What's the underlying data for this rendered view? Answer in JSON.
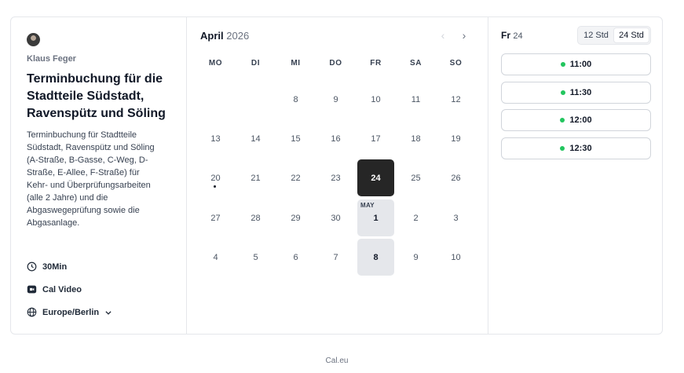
{
  "organizer": {
    "name": "Klaus Feger"
  },
  "event": {
    "title": "Terminbuchung für die Stadtteile Südstadt, Ravenspütz und Söling",
    "description": "Terminbuchung für Stadtteile Südstadt, Ravenspütz und Söling (A-Straße, B-Gasse, C-Weg, D-Straße, E-Allee, F-Straße) für Kehr- und Überprüfungsarbeiten (alle 2 Jahre) und die Abgaswegeprüfung sowie die Abgasanlage.",
    "duration": "30Min",
    "location": "Cal Video",
    "timezone": "Europe/Berlin"
  },
  "calendar": {
    "month": "April",
    "year": "2026",
    "weekdays": [
      "MO",
      "DI",
      "MI",
      "DO",
      "FR",
      "SA",
      "SO"
    ],
    "rows": [
      [
        null,
        null,
        "8",
        "9",
        "10",
        "11",
        "12"
      ],
      [
        "13",
        "14",
        "15",
        "16",
        "17",
        "18",
        "19"
      ],
      [
        "20",
        "21",
        "22",
        "23",
        "24",
        "25",
        "26"
      ],
      [
        "27",
        "28",
        "29",
        "30",
        "1",
        "2",
        "3"
      ],
      [
        "4",
        "5",
        "6",
        "7",
        "8",
        "9",
        "10"
      ]
    ],
    "selected": "24",
    "available": [
      "24",
      "1",
      "8"
    ],
    "next_month_label": "MAY",
    "today_marker": "20"
  },
  "schedule": {
    "day_label": "Fr",
    "day_number": "24",
    "format_options": [
      "12 Std",
      "24 Std"
    ],
    "active_format": "24 Std",
    "slots": [
      "11:00",
      "11:30",
      "12:00",
      "12:30"
    ],
    "slot_color": "#22c55e"
  },
  "footer": {
    "brand": "Cal.eu"
  }
}
